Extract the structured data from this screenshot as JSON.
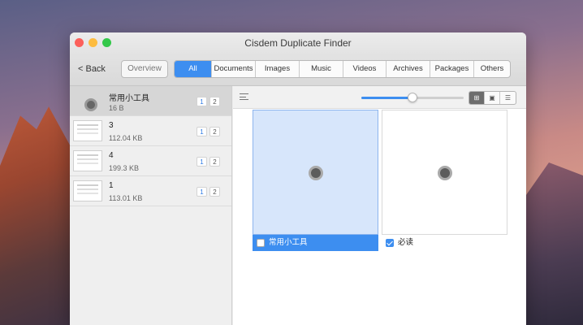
{
  "window": {
    "title": "Cisdem Duplicate Finder"
  },
  "toolbar": {
    "back_label": "< Back",
    "overview_label": "Overview",
    "tabs": [
      {
        "label": "All",
        "active": true
      },
      {
        "label": "Documents"
      },
      {
        "label": "Images"
      },
      {
        "label": "Music"
      },
      {
        "label": "Videos"
      },
      {
        "label": "Archives"
      },
      {
        "label": "Packages"
      },
      {
        "label": "Others"
      }
    ]
  },
  "sidebar": {
    "items": [
      {
        "title": "常用小工具",
        "size": "16 B",
        "selected": true,
        "badges": [
          "1",
          "2"
        ]
      },
      {
        "title": "3",
        "size": "112.04 KB",
        "badges": [
          "1",
          "2"
        ]
      },
      {
        "title": "4",
        "size": "199.3 KB",
        "badges": [
          "1",
          "2"
        ]
      },
      {
        "title": "1",
        "size": "113.01 KB",
        "badges": [
          "1",
          "2"
        ]
      }
    ]
  },
  "main": {
    "slider_value": 0.5,
    "view_buttons": [
      "⊞",
      "▣",
      "☰"
    ],
    "cards": [
      {
        "label": "常用小工具",
        "checked": false,
        "selected": true
      },
      {
        "label": "必读",
        "checked": true,
        "selected": false
      }
    ]
  },
  "colors": {
    "accent": "#3d8ef0"
  }
}
